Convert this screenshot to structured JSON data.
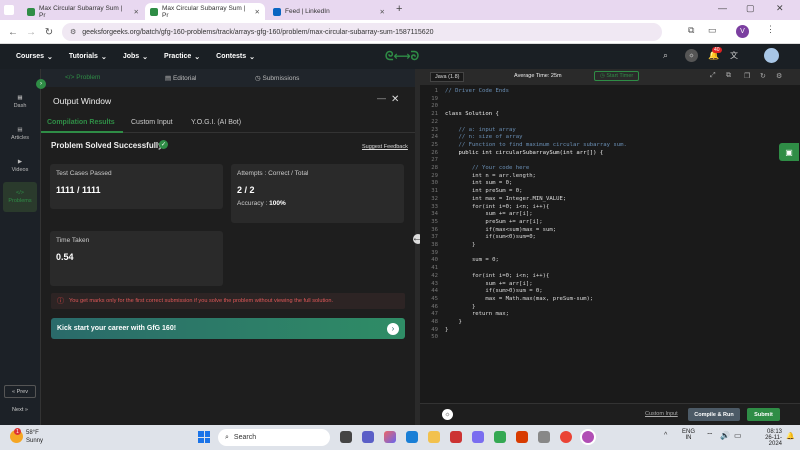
{
  "browser": {
    "tabs": [
      {
        "title": "Max Circular Subarray Sum | Pr",
        "color": "#2f8d46"
      },
      {
        "title": "Max Circular Subarray Sum | Pr",
        "color": "#2f8d46"
      },
      {
        "title": "Feed | LinkedIn",
        "color": "#0a66c2"
      }
    ],
    "new_tab": "+",
    "url": "geeksforgeeks.org/batch/gfg-160-problems/track/arrays-gfg-160/problem/max-circular-subarray-sum-1587115620",
    "profile_letter": "V"
  },
  "gfg_nav": {
    "items": [
      "Courses",
      "Tutorials",
      "Jobs",
      "Practice",
      "Contests"
    ],
    "logo": "GfG",
    "notif_count": "40"
  },
  "left_rail": {
    "items": [
      "Dash",
      "Articles",
      "Videos",
      "Problems"
    ],
    "prev": "« Prev",
    "next": "Next »"
  },
  "problem_tabs": [
    "Problem",
    "Editorial",
    "Submissions"
  ],
  "output": {
    "title": "Output Window",
    "tabs": [
      "Compilation Results",
      "Custom Input",
      "Y.O.G.I. (AI Bot)"
    ],
    "status": "Problem Solved Successfully",
    "suggest": "Suggest Feedback",
    "tests_label": "Test Cases Passed",
    "tests_value": "1111 / 1111",
    "attempts_label": "Attempts : Correct / Total",
    "attempts_value": "2 / 2",
    "accuracy_label": "Accuracy :",
    "accuracy_value": "100%",
    "time_label": "Time Taken",
    "time_value": "0.54",
    "warning": "You get marks only for the first correct submission if you solve the problem without viewing the full solution.",
    "banner": "Kick start your career with GfG 160!"
  },
  "editor": {
    "language": "Java (1.8)",
    "avg_time": "Average Time: 25m",
    "timer": "Start Timer",
    "code_lines": [
      {
        "n": "1",
        "t": "// Driver Code Ends"
      },
      {
        "n": "19",
        "t": ""
      },
      {
        "n": "20",
        "t": ""
      },
      {
        "n": "21",
        "t": "class Solution {"
      },
      {
        "n": "22",
        "t": ""
      },
      {
        "n": "23",
        "t": "    // a: input array"
      },
      {
        "n": "24",
        "t": "    // n: size of array"
      },
      {
        "n": "25",
        "t": "    // Function to find maximum circular subarray sum."
      },
      {
        "n": "26",
        "t": "    public int circularSubarraySum(int arr[]) {"
      },
      {
        "n": "27",
        "t": ""
      },
      {
        "n": "28",
        "t": "        // Your code here"
      },
      {
        "n": "29",
        "t": "        int n = arr.length;"
      },
      {
        "n": "30",
        "t": "        int sum = 0;"
      },
      {
        "n": "31",
        "t": "        int preSum = 0;"
      },
      {
        "n": "32",
        "t": "        int max = Integer.MIN_VALUE;"
      },
      {
        "n": "33",
        "t": "        for(int i=0; i<n; i++){"
      },
      {
        "n": "34",
        "t": "            sum += arr[i];"
      },
      {
        "n": "35",
        "t": "            preSum += arr[i];"
      },
      {
        "n": "36",
        "t": "            if(max<sum)max = sum;"
      },
      {
        "n": "37",
        "t": "            if(sum<0)sum=0;"
      },
      {
        "n": "38",
        "t": "        }"
      },
      {
        "n": "39",
        "t": ""
      },
      {
        "n": "40",
        "t": "        sum = 0;"
      },
      {
        "n": "41",
        "t": ""
      },
      {
        "n": "42",
        "t": "        for(int i=0; i<n; i++){"
      },
      {
        "n": "43",
        "t": "            sum += arr[i];"
      },
      {
        "n": "44",
        "t": "            if(sum>0)sum = 0;"
      },
      {
        "n": "45",
        "t": "            max = Math.max(max, preSum-sum);"
      },
      {
        "n": "46",
        "t": "        }"
      },
      {
        "n": "47",
        "t": "        return max;"
      },
      {
        "n": "48",
        "t": "    }"
      },
      {
        "n": "49",
        "t": "}"
      },
      {
        "n": "50",
        "t": ""
      }
    ],
    "custom_input": "Custom Input",
    "compile": "Compile & Run",
    "submit": "Submit"
  },
  "taskbar": {
    "weather_temp": "58°F",
    "weather_desc": "Sunny",
    "search": "Search",
    "lang1": "ENG",
    "lang2": "IN",
    "time": "08:13",
    "date": "26-11-2024",
    "weather_badge": "1"
  },
  "colors": {
    "green": "#2f8d46",
    "accent_purple": "#7b3fa0"
  }
}
